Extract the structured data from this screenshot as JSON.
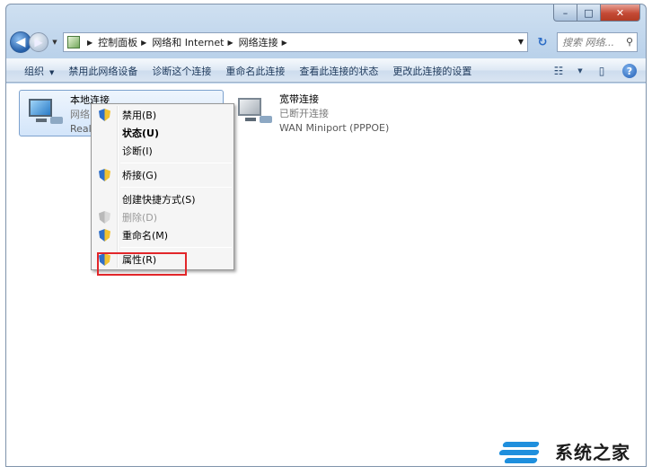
{
  "window": {
    "buttons": {
      "minimize": "–",
      "maximize": "□",
      "close": "✕"
    }
  },
  "nav": {
    "back_icon": "back-arrow-icon",
    "forward_icon": "forward-arrow-icon",
    "breadcrumbs": [
      "控制面板",
      "网络和 Internet",
      "网络连接"
    ],
    "search_placeholder": "搜索 网络..."
  },
  "toolbar": {
    "items": [
      "组织",
      "禁用此网络设备",
      "诊断这个连接",
      "重命名此连接",
      "查看此连接的状态",
      "更改此连接的设置"
    ]
  },
  "connections": [
    {
      "name": "本地连接",
      "status": "网络",
      "device": "Realt"
    },
    {
      "name": "宽带连接",
      "status": "已断开连接",
      "device": "WAN Miniport (PPPOE)"
    }
  ],
  "context_menu": {
    "items": [
      {
        "label": "禁用(B)",
        "shield": true
      },
      {
        "label": "状态(U)",
        "bold": true
      },
      {
        "label": "诊断(I)"
      },
      {
        "label": "桥接(G)",
        "shield": true
      },
      {
        "label": "创建快捷方式(S)"
      },
      {
        "label": "删除(D)",
        "disabled": true,
        "shield": true
      },
      {
        "label": "重命名(M)",
        "shield": true
      },
      {
        "label": "属性(R)",
        "shield": true
      }
    ],
    "highlight_color": "#e2262a"
  },
  "watermark": {
    "text": "系统之家"
  }
}
